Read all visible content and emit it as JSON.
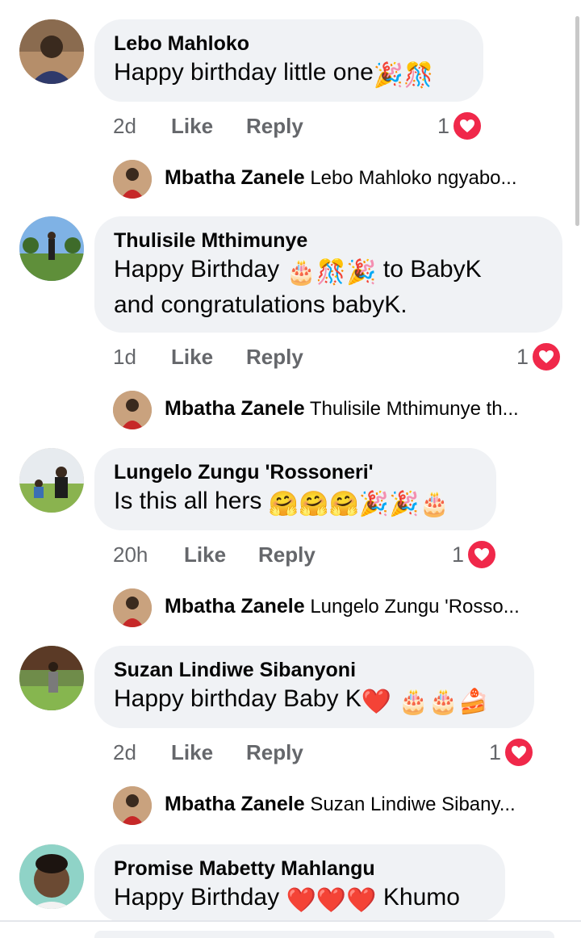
{
  "comments": [
    {
      "author": "Lebo Mahloko",
      "text": "Happy birthday little one",
      "emojis": [
        "🎉",
        "🎊"
      ],
      "time": "2d",
      "like": "Like",
      "reply": "Reply",
      "reactions": "1",
      "reply_preview": {
        "author": "Mbatha Zanele",
        "snippet": "Lebo Mahloko ngyabo..."
      }
    },
    {
      "author": "Thulisile Mthimunye",
      "text_line1": "Happy Birthday",
      "emojis": [
        "🎂",
        "🎊",
        "🎉"
      ],
      "text_after": "to BabyK",
      "text_line2": "and congratulations babyK.",
      "time": "1d",
      "like": "Like",
      "reply": "Reply",
      "reactions": "1",
      "reply_preview": {
        "author": "Mbatha Zanele",
        "snippet": "Thulisile Mthimunye th..."
      }
    },
    {
      "author": "Lungelo Zungu 'Rossoneri'",
      "text": "Is this all hers",
      "emojis": [
        "🤗",
        "🤗",
        "🤗",
        "🎉",
        "🎉",
        "🎂"
      ],
      "time": "20h",
      "like": "Like",
      "reply": "Reply",
      "reactions": "1",
      "reply_preview": {
        "author": "Mbatha Zanele",
        "snippet": "Lungelo Zungu 'Rosso..."
      }
    },
    {
      "author": "Suzan Lindiwe Sibanyoni",
      "text": "Happy birthday Baby K",
      "emojis": [
        "❤️",
        "🎂",
        "🎂",
        "🍰"
      ],
      "time": "2d",
      "like": "Like",
      "reply": "Reply",
      "reactions": "1",
      "reply_preview": {
        "author": "Mbatha Zanele",
        "snippet": "Suzan Lindiwe Sibany..."
      }
    },
    {
      "author": "Promise Mabetty Mahlangu",
      "text_before": "Happy Birthday",
      "emojis": [
        "❤️",
        "❤️",
        "❤️"
      ],
      "text_after": "Khumo"
    }
  ],
  "icons": {
    "reaction": "heart-icon",
    "reaction_color": "#f0284a"
  }
}
